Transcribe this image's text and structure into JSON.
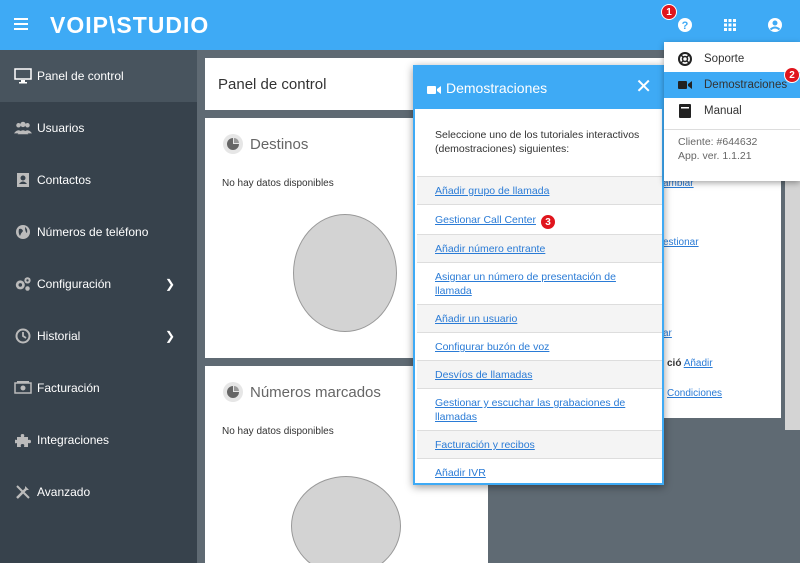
{
  "topbar": {
    "logo": "VOIP\\STUDIO",
    "badge_help": "1"
  },
  "sidebar": {
    "items": [
      {
        "label": "Panel de control",
        "icon": "monitor-icon"
      },
      {
        "label": "Usuarios",
        "icon": "users-icon"
      },
      {
        "label": "Contactos",
        "icon": "contacts-icon"
      },
      {
        "label": "Números de teléfono",
        "icon": "globe-icon"
      },
      {
        "label": "Configuración",
        "icon": "gears-icon"
      },
      {
        "label": "Historial",
        "icon": "history-icon"
      },
      {
        "label": "Facturación",
        "icon": "billing-icon"
      },
      {
        "label": "Integraciones",
        "icon": "puzzle-icon"
      },
      {
        "label": "Avanzado",
        "icon": "tools-icon"
      }
    ]
  },
  "main": {
    "page_title": "Panel de control",
    "cards": [
      {
        "title": "Destinos",
        "empty": "No hay datos disponibles"
      },
      {
        "title": "Números marcados",
        "empty": "No hay datos disponibles"
      }
    ],
    "right_panel": {
      "rows": [
        {
          "text": "ambiar",
          "link": true
        },
        {
          "text": "estionar",
          "link": true
        },
        {
          "text": "ar",
          "link": true
        },
        {
          "prefix": "ció",
          "text": "Añadir",
          "link": true
        },
        {
          "text": "Condiciones",
          "link": true
        }
      ]
    }
  },
  "modal": {
    "title": "Demostraciones",
    "intro": "Seleccione uno de los tutoriales interactivos (demostraciones) siguientes:",
    "items": [
      "Añadir grupo de llamada",
      "Gestionar Call Center",
      "Añadir número entrante",
      "Asignar un número de presentación de llamada",
      "Añadir un usuario",
      "Configurar buzón de voz",
      "Desvíos de llamadas",
      "Gestionar y escuchar las grabaciones de llamadas",
      "Facturación y recibos",
      "Añadir IVR"
    ],
    "badge_item": "3"
  },
  "dropdown": {
    "items": [
      {
        "label": "Soporte",
        "icon": "lifebuoy-icon"
      },
      {
        "label": "Demostraciones",
        "icon": "video-camera-icon"
      },
      {
        "label": "Manual",
        "icon": "book-icon"
      }
    ],
    "badge_demo": "2",
    "client": "Cliente: #644632",
    "version": "App. ver. 1.1.21"
  },
  "colors": {
    "accent": "#3eaaf5",
    "sidebar": "#37424c",
    "badge": "#e0151d",
    "link": "#2a7bd6"
  }
}
